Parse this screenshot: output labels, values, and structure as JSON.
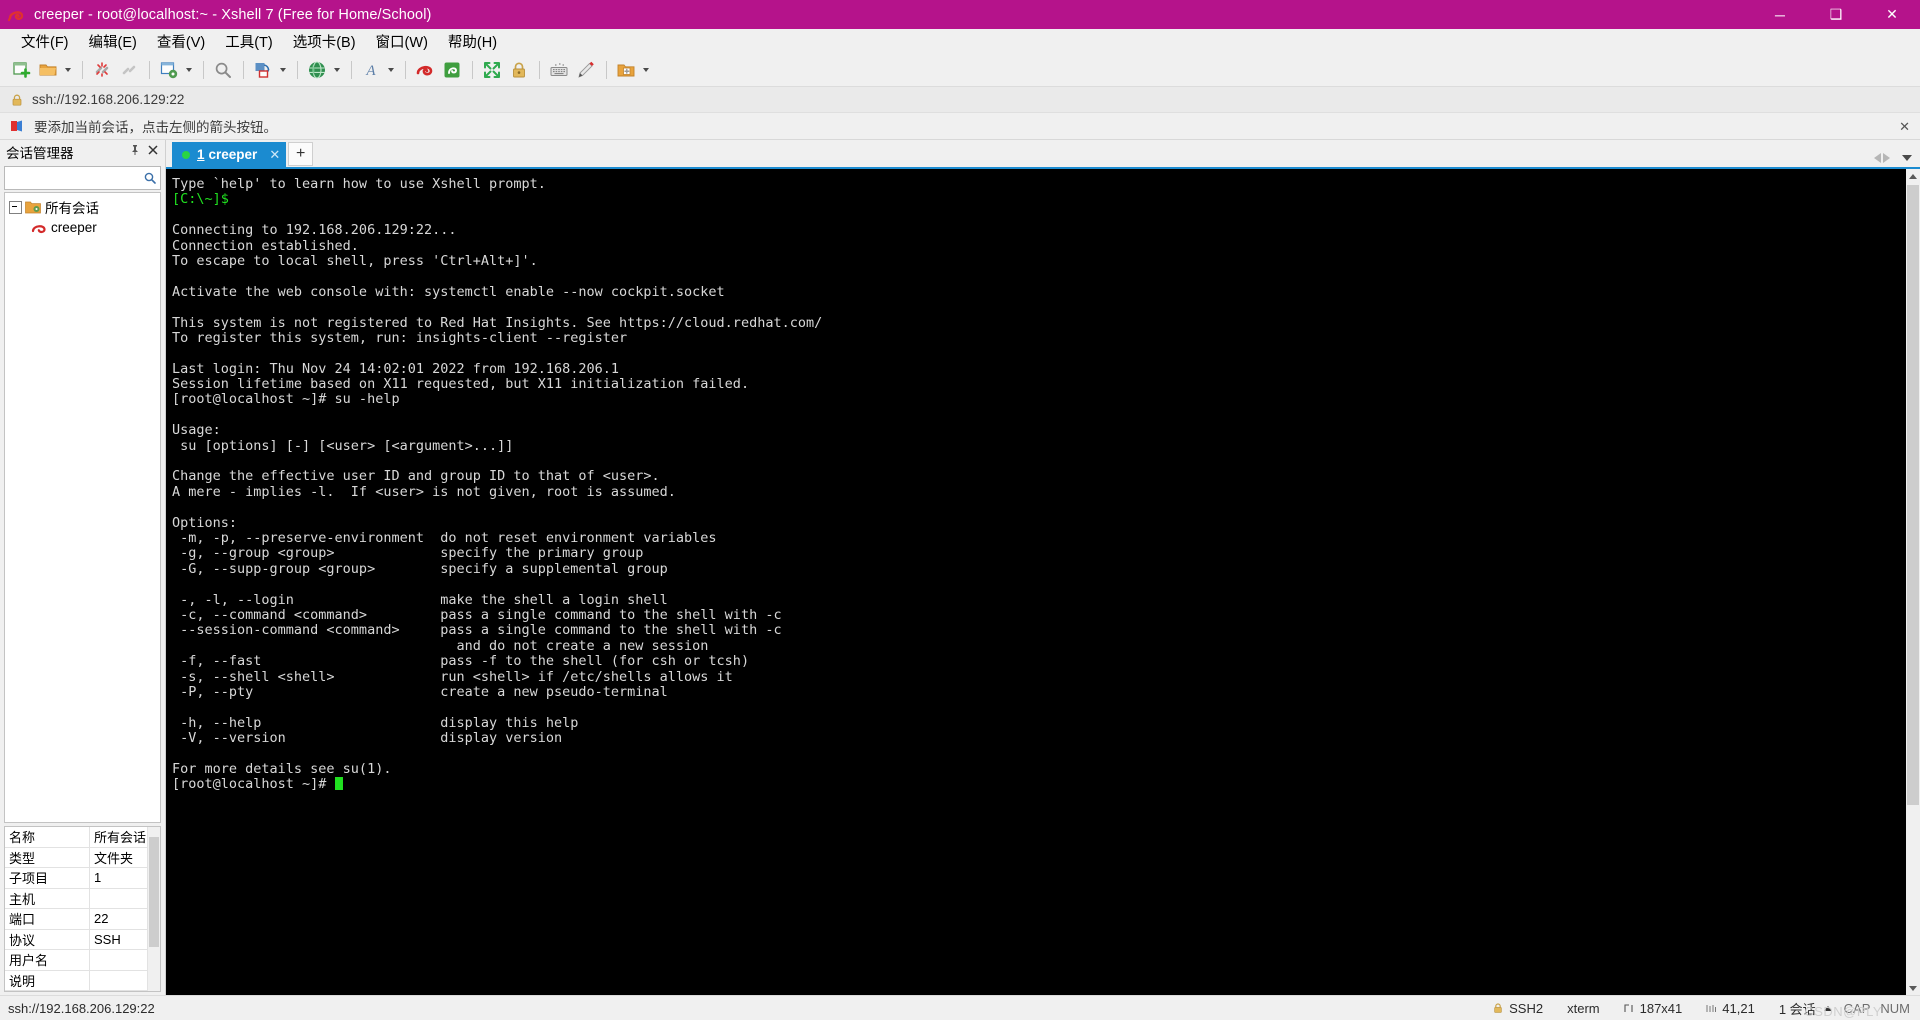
{
  "window": {
    "title": "creeper - root@localhost:~ - Xshell 7 (Free for Home/School)",
    "app_icon": "xshell-snail-icon",
    "accent_color": "#b5138b",
    "minimize_label": "─",
    "maximize_label": "❑",
    "close_label": "✕"
  },
  "menubar": {
    "items": [
      {
        "label": "文件(F)",
        "name": "menu-file"
      },
      {
        "label": "编辑(E)",
        "name": "menu-edit"
      },
      {
        "label": "查看(V)",
        "name": "menu-view"
      },
      {
        "label": "工具(T)",
        "name": "menu-tools"
      },
      {
        "label": "选项卡(B)",
        "name": "menu-tabs"
      },
      {
        "label": "窗口(W)",
        "name": "menu-window"
      },
      {
        "label": "帮助(H)",
        "name": "menu-help"
      }
    ]
  },
  "toolbar": {
    "icons": [
      "new-session-icon",
      "open-folder-icon",
      "disconnect-icon",
      "reconnect-icon",
      "session-properties-icon",
      "find-icon",
      "transfer-file-icon",
      "web-browser-icon",
      "font-icon",
      "xshell-icon",
      "xftp-icon",
      "fullscreen-icon",
      "lock-icon",
      "keyboard-icon",
      "highlight-pen-icon",
      "add-folder-icon"
    ]
  },
  "addressbar": {
    "lock_icon": "padlock-icon",
    "url": "ssh://192.168.206.129:22"
  },
  "notice": {
    "icon": "red-arrow-icon",
    "text": "要添加当前会话，点击左侧的箭头按钮。",
    "close_label": "✕"
  },
  "session_manager": {
    "title": "会话管理器",
    "pin_icon": "pin-icon",
    "close_icon": "close-icon",
    "search_icon": "search-icon",
    "search_value": "",
    "search_placeholder": "",
    "tree": [
      {
        "label": "所有会话",
        "icon": "folder-icon",
        "level": 0
      },
      {
        "label": "creeper",
        "icon": "xshell-session-icon",
        "level": 1
      }
    ],
    "properties": [
      {
        "key": "名称",
        "value": "所有会话"
      },
      {
        "key": "类型",
        "value": "文件夹"
      },
      {
        "key": "子项目",
        "value": "1"
      },
      {
        "key": "主机",
        "value": ""
      },
      {
        "key": "端口",
        "value": "22"
      },
      {
        "key": "协议",
        "value": "SSH"
      },
      {
        "key": "用户名",
        "value": ""
      },
      {
        "key": "说明",
        "value": ""
      }
    ]
  },
  "tabbar": {
    "tabs": [
      {
        "status_dot": "connected",
        "number": "1",
        "label": "creeper",
        "close_label": "✕",
        "active": true
      }
    ],
    "add_tab_label": "+",
    "nav_prev_icon": "chevron-left-icon",
    "nav_next_icon": "chevron-right-icon",
    "nav_menu_icon": "chevron-down-icon"
  },
  "terminal": {
    "background": "#000000",
    "foreground": "#d8d8d8",
    "prompt_color": "#20e020",
    "lines": [
      {
        "text": "Type `help' to learn how to use Xshell prompt."
      },
      {
        "text": "[C:\\~]$",
        "color": "green"
      },
      {
        "text": ""
      },
      {
        "text": "Connecting to 192.168.206.129:22..."
      },
      {
        "text": "Connection established."
      },
      {
        "text": "To escape to local shell, press 'Ctrl+Alt+]'."
      },
      {
        "text": ""
      },
      {
        "text": "Activate the web console with: systemctl enable --now cockpit.socket"
      },
      {
        "text": ""
      },
      {
        "text": "This system is not registered to Red Hat Insights. See https://cloud.redhat.com/"
      },
      {
        "text": "To register this system, run: insights-client --register"
      },
      {
        "text": ""
      },
      {
        "text": "Last login: Thu Nov 24 14:02:01 2022 from 192.168.206.1"
      },
      {
        "text": "Session lifetime based on X11 requested, but X11 initialization failed."
      },
      {
        "text": "[root@localhost ~]# su -help"
      },
      {
        "text": ""
      },
      {
        "text": "Usage:"
      },
      {
        "text": " su [options] [-] [<user> [<argument>...]]"
      },
      {
        "text": ""
      },
      {
        "text": "Change the effective user ID and group ID to that of <user>."
      },
      {
        "text": "A mere - implies -l.  If <user> is not given, root is assumed."
      },
      {
        "text": ""
      },
      {
        "text": "Options:"
      },
      {
        "text": " -m, -p, --preserve-environment  do not reset environment variables"
      },
      {
        "text": " -g, --group <group>             specify the primary group"
      },
      {
        "text": " -G, --supp-group <group>        specify a supplemental group"
      },
      {
        "text": ""
      },
      {
        "text": " -, -l, --login                  make the shell a login shell"
      },
      {
        "text": " -c, --command <command>         pass a single command to the shell with -c"
      },
      {
        "text": " --session-command <command>     pass a single command to the shell with -c"
      },
      {
        "text": "                                   and do not create a new session"
      },
      {
        "text": " -f, --fast                      pass -f to the shell (for csh or tcsh)"
      },
      {
        "text": " -s, --shell <shell>             run <shell> if /etc/shells allows it"
      },
      {
        "text": " -P, --pty                       create a new pseudo-terminal"
      },
      {
        "text": ""
      },
      {
        "text": " -h, --help                      display this help"
      },
      {
        "text": " -V, --version                   display version"
      },
      {
        "text": ""
      },
      {
        "text": "For more details see su(1)."
      },
      {
        "text": "[root@localhost ~]# ",
        "cursor": true
      }
    ]
  },
  "statusbar": {
    "connection": "ssh://192.168.206.129:22",
    "protocol": "SSH2",
    "protocol_icon": "padlock-icon",
    "terminal_type": "xterm",
    "size": "187x41",
    "size_icon": "terminal-size-icon",
    "cursor_pos": "41,21",
    "cursor_icon": "cursor-pos-icon",
    "sessions": "1 会话",
    "caps": "CAP",
    "num": "NUM",
    "watermark": "CSDN@PLY"
  }
}
